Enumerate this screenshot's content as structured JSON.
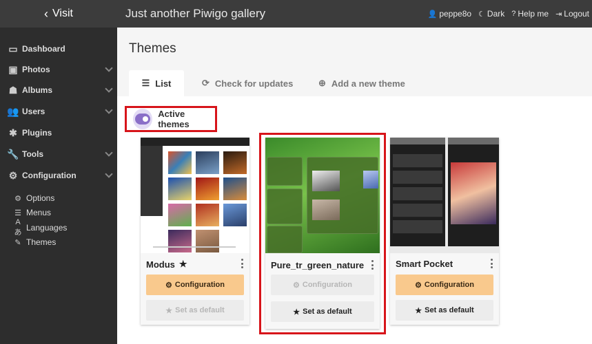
{
  "topbar": {
    "visit_label": "Visit",
    "gallery_title": "Just another Piwigo gallery",
    "user_label": "peppe8o",
    "dark_label": "Dark",
    "help_label": "Help me",
    "logout_label": "Logout"
  },
  "sidebar": {
    "items": [
      {
        "label": "Dashboard",
        "icon": "monitor-icon"
      },
      {
        "label": "Photos",
        "icon": "image-icon"
      },
      {
        "label": "Albums",
        "icon": "sitemap-icon"
      },
      {
        "label": "Users",
        "icon": "users-icon"
      },
      {
        "label": "Plugins",
        "icon": "puzzle-icon"
      },
      {
        "label": "Tools",
        "icon": "wrench-icon"
      },
      {
        "label": "Configuration",
        "icon": "gear-icon"
      }
    ],
    "subitems": [
      {
        "label": "Options",
        "icon": "cogs-icon"
      },
      {
        "label": "Menus",
        "icon": "bars-icon"
      },
      {
        "label": "Languages",
        "icon": "language-icon"
      },
      {
        "label": "Themes",
        "icon": "brush-icon"
      }
    ]
  },
  "main": {
    "title": "Themes",
    "tabs": [
      {
        "label": "List"
      },
      {
        "label": "Check for updates"
      },
      {
        "label": "Add a new theme"
      }
    ],
    "active_themes_label": "Active themes",
    "themes": [
      {
        "name": "Modus",
        "config_label": "Configuration",
        "default_label": "Set as default",
        "is_default": true
      },
      {
        "name": "Pure_tr_green_nature",
        "config_label": "Configuration",
        "default_label": "Set as default",
        "is_default": false
      },
      {
        "name": "Smart Pocket",
        "config_label": "Configuration",
        "default_label": "Set as default",
        "is_default": false
      }
    ]
  },
  "colors": {
    "sidebar_bg": "#2d2d2d",
    "topbar_bg": "#3c3c3c",
    "config_button": "#f9c98d",
    "highlight": "#d7141a",
    "toggle": "#8a6fc8"
  }
}
